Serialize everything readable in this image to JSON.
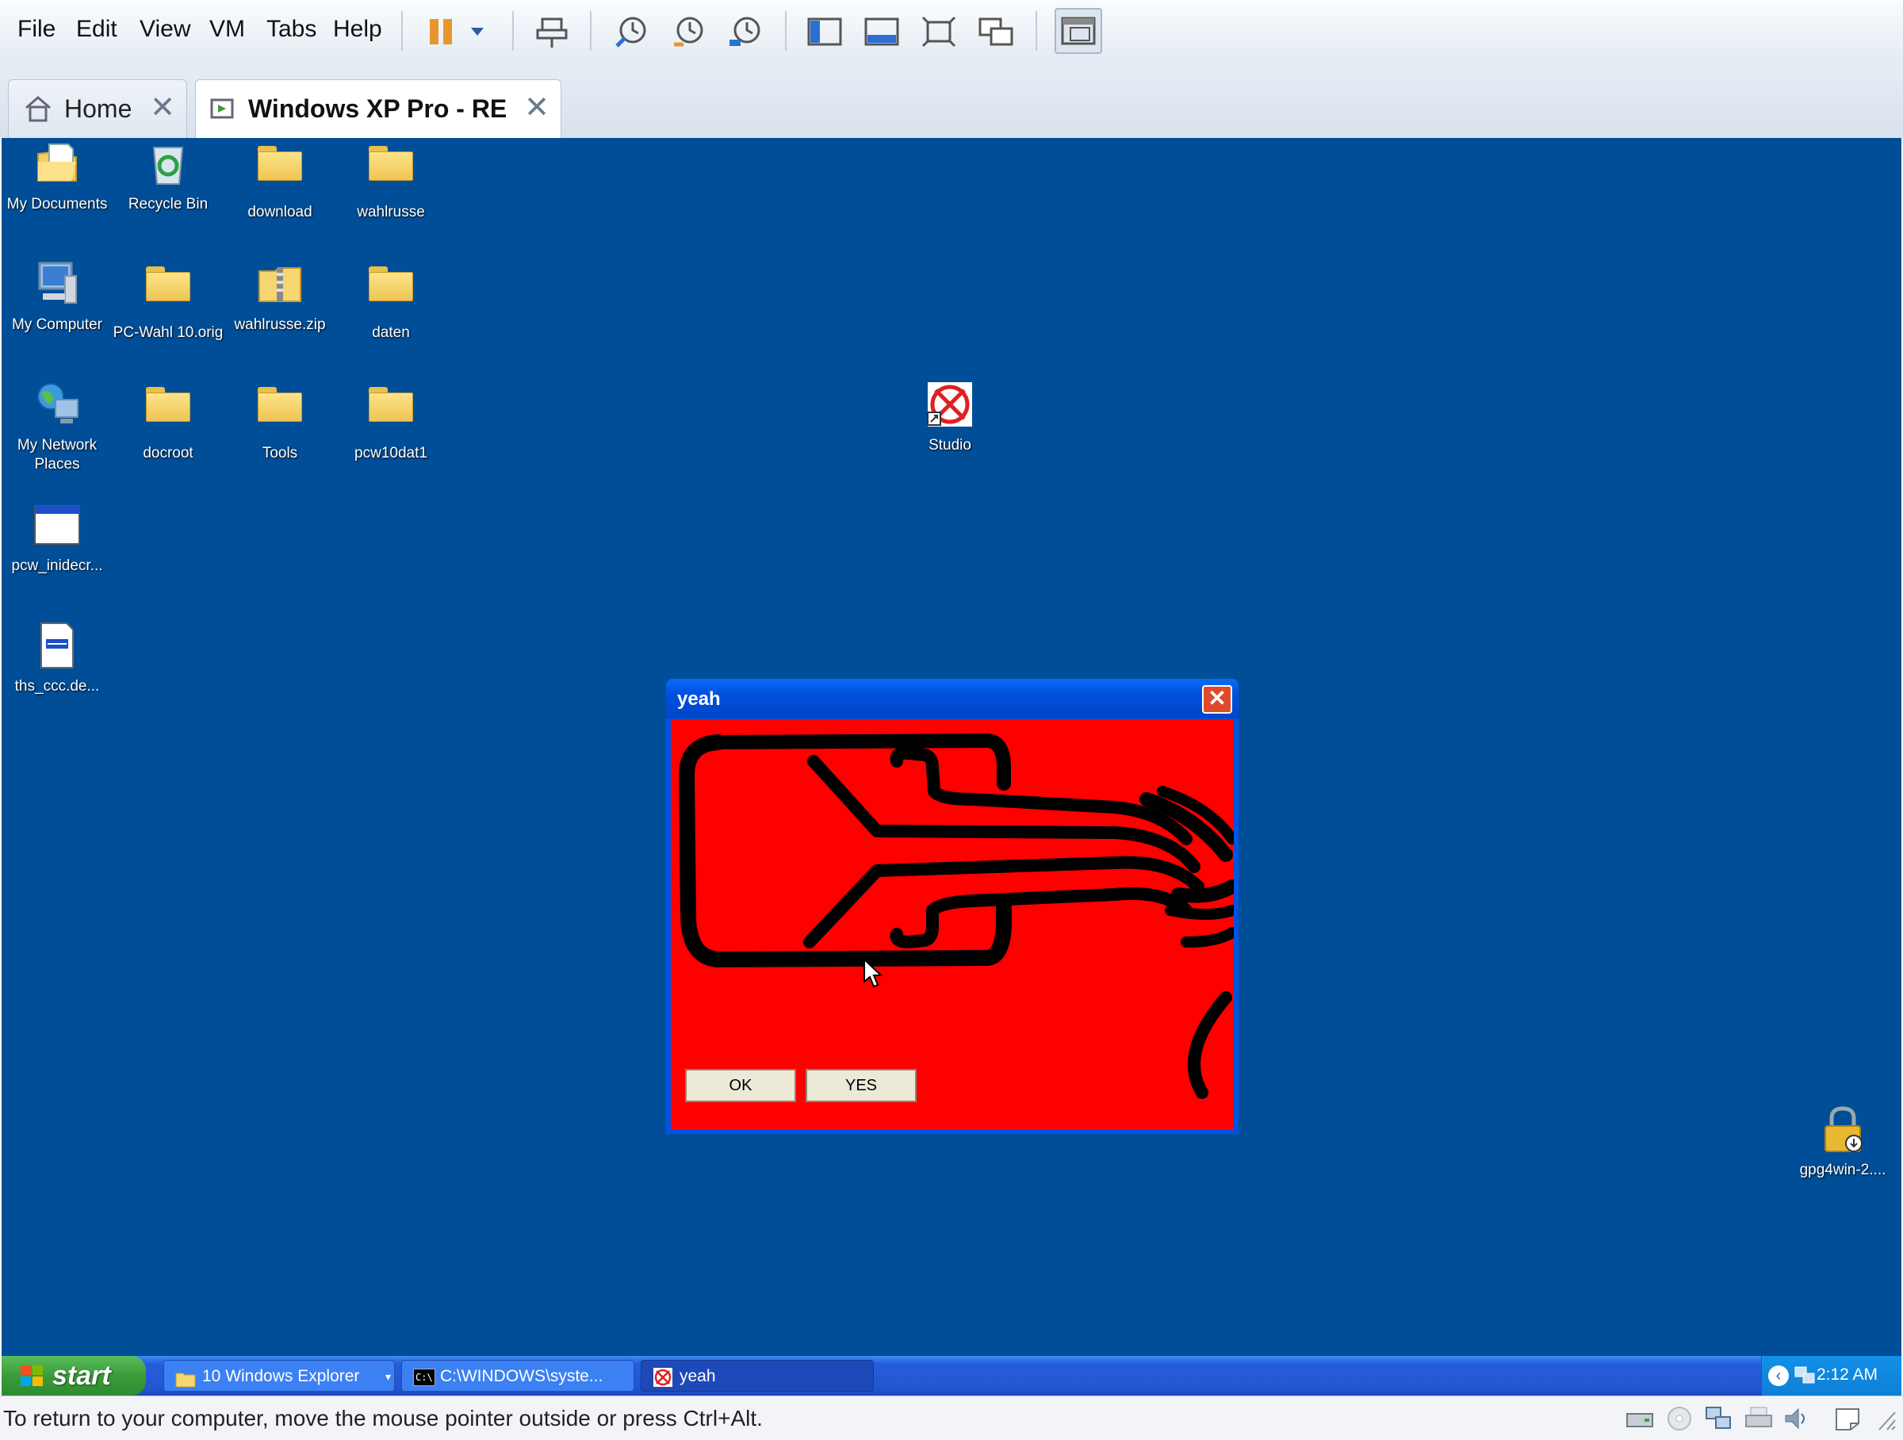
{
  "menu": {
    "items": [
      {
        "label": "File"
      },
      {
        "label": "Edit"
      },
      {
        "label": "View"
      },
      {
        "label": "VM"
      },
      {
        "label": "Tabs"
      },
      {
        "label": "Help"
      }
    ]
  },
  "toolbar": {
    "icons": [
      "pause-icon",
      "dropdown-arrow-icon",
      "send-ctrl-alt-del-icon",
      "snapshot-take-icon",
      "snapshot-revert-icon",
      "snapshot-manager-icon",
      "show-sidebar-icon",
      "show-thumbnail-bar-icon",
      "full-screen-icon",
      "unity-icon",
      "console-view-icon"
    ]
  },
  "tabs": [
    {
      "label": "Home",
      "active": false
    },
    {
      "label": "Windows XP Pro - RE",
      "active": true
    }
  ],
  "desktop": {
    "icons": [
      {
        "label": "My Documents",
        "type": "my-documents"
      },
      {
        "label": "Recycle Bin",
        "type": "recycle-bin"
      },
      {
        "label": "download",
        "type": "folder"
      },
      {
        "label": "wahlrusse",
        "type": "folder"
      },
      {
        "label": "My Computer",
        "type": "my-computer"
      },
      {
        "label": "PC-Wahl 10.orig",
        "type": "folder"
      },
      {
        "label": "wahlrusse.zip",
        "type": "zip"
      },
      {
        "label": "daten",
        "type": "folder"
      },
      {
        "label": "My Network Places",
        "type": "network"
      },
      {
        "label": "docroot",
        "type": "folder"
      },
      {
        "label": "Tools",
        "type": "folder"
      },
      {
        "label": "pcw10dat1",
        "type": "folder"
      },
      {
        "label": "pcw_inidecr...",
        "type": "app-window"
      },
      {
        "label": "ths_ccc.de...",
        "type": "document"
      },
      {
        "label": "Studio",
        "type": "shortcut-broken"
      },
      {
        "label": "gpg4win-2....",
        "type": "installer-lock"
      }
    ]
  },
  "dialog": {
    "title": "yeah",
    "ok_label": "OK",
    "yes_label": "YES"
  },
  "taskbar": {
    "start_label": "start",
    "items": [
      {
        "label": "10 Windows Explorer"
      },
      {
        "label": "C:\\WINDOWS\\syste..."
      },
      {
        "label": "yeah"
      }
    ],
    "clock": "2:12 AM"
  },
  "statusbar": {
    "text": "To return to your computer, move the mouse pointer outside or press Ctrl+Alt."
  },
  "colors": {
    "desktop_bg": "#004e98",
    "dialog_client_bg": "#ff0000",
    "taskbar_bg": "#245edb",
    "start_green": "#3a9c3a"
  }
}
